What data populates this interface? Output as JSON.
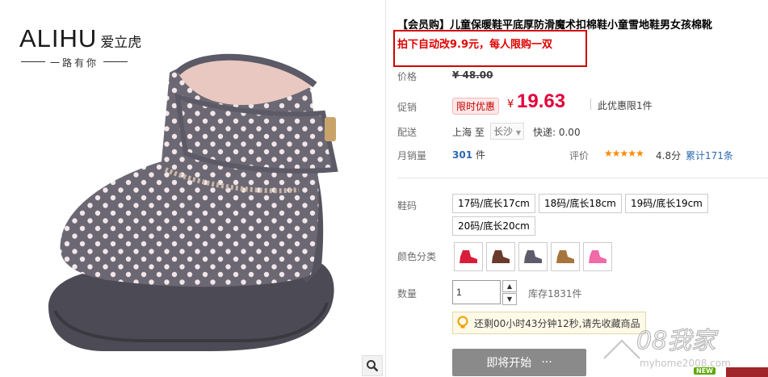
{
  "brand": {
    "latin": "ALIHU",
    "cn": "爱立虎",
    "slogan": "一路有你"
  },
  "product": {
    "title": "【会员购】儿童保暖鞋平底厚防滑魔术扣棉鞋小童雪地鞋男女孩棉靴",
    "promo_notice": "拍下自动改9.9元，每人限购一双"
  },
  "price": {
    "label": "价格",
    "original": "¥ 48.00"
  },
  "promotion": {
    "label": "促销",
    "tag": "限时优惠",
    "currency": "¥",
    "price": "19.63",
    "limit_note": "此优惠限1件"
  },
  "shipping": {
    "label": "配送",
    "from": "上海 至",
    "to": "长沙",
    "fee": "快递: 0.00"
  },
  "sales": {
    "label": "月销量",
    "count": "301",
    "unit": "件",
    "rating_label": "评价",
    "stars": "★★★★★",
    "score": "4.8分",
    "reviews": "累计171条"
  },
  "size": {
    "label": "鞋码",
    "options": [
      "17码/底长17cm",
      "18码/底长18cm",
      "19码/底长19cm",
      "20码/底长20cm"
    ]
  },
  "color": {
    "label": "颜色分类",
    "swatches": [
      {
        "name": "red",
        "color": "#d81e3a"
      },
      {
        "name": "brown",
        "color": "#6a3a2a"
      },
      {
        "name": "gray",
        "color": "#5e5c6a"
      },
      {
        "name": "tan",
        "color": "#a8743e"
      },
      {
        "name": "pink",
        "color": "#f06ba8"
      }
    ]
  },
  "quantity": {
    "label": "数量",
    "value": "1",
    "up": "▲",
    "down": "▼",
    "stock": "库存1831件"
  },
  "notice": {
    "text": "还剩00小时43分钟12秒,请先收藏商品",
    "icon": "lightbulb-icon"
  },
  "action": {
    "start_label": "即将开始",
    "dots": "···"
  },
  "badge": {
    "new": "NEW"
  },
  "watermark": {
    "text": "08我家",
    "url": "myhome2008.com"
  },
  "colors": {
    "accent": "#e4003a",
    "promo_border": "#d10000",
    "link": "#2b68b0",
    "star": "#ff8a00"
  }
}
